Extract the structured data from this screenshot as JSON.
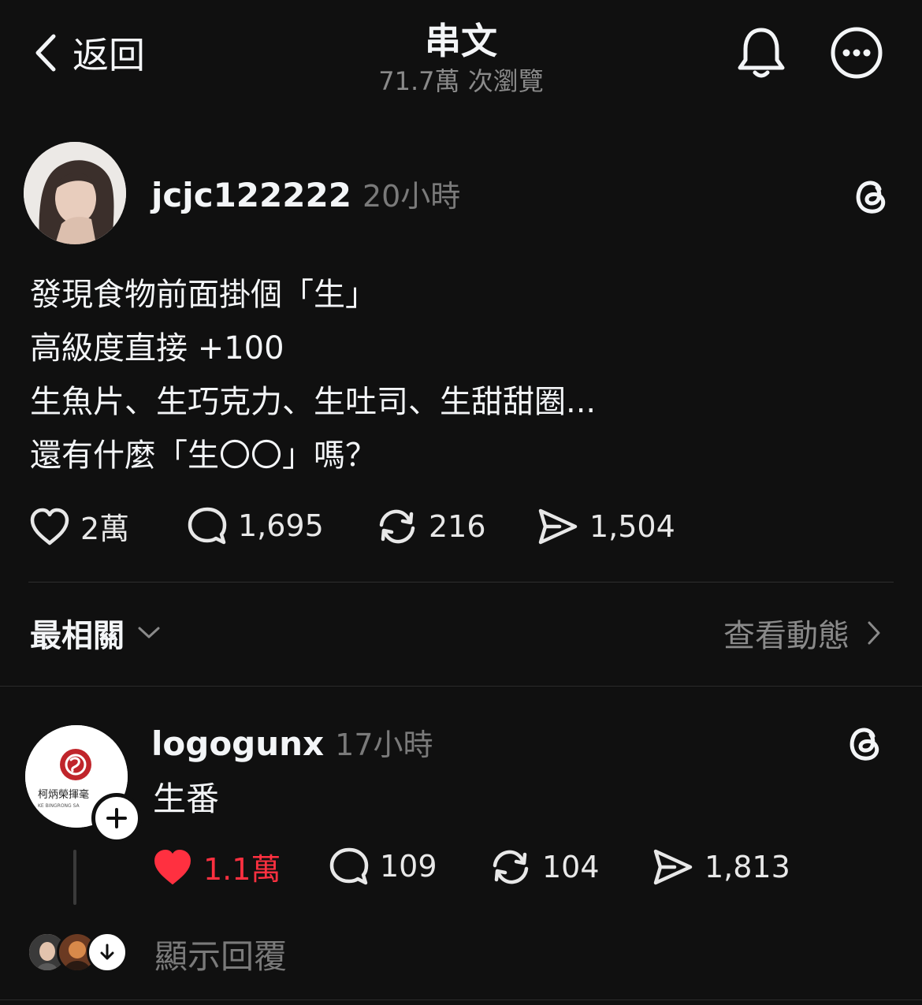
{
  "header": {
    "back_label": "返回",
    "title": "串文",
    "views": "71.7萬 次瀏覽"
  },
  "post": {
    "username": "jcjc122222",
    "time": "20小時",
    "lines": [
      "發現食物前面掛個「生」",
      "高級度直接 +100",
      "生魚片、生巧克力、生吐司、生甜甜圈...",
      "還有什麼「生〇〇」嗎？"
    ],
    "likes": "2萬",
    "comments": "1,695",
    "reposts": "216",
    "shares": "1,504"
  },
  "sort": {
    "label": "最相關",
    "activity_link": "查看動態"
  },
  "reply": {
    "username": "logogunx",
    "time": "17小時",
    "text": "生番",
    "likes": "1.1萬",
    "comments": "109",
    "reposts": "104",
    "shares": "1,813",
    "avatar_logo_text": "柯炳榮揮毫",
    "avatar_logo_sub": "KE BINGRONG SA",
    "show_replies": "顯示回覆"
  },
  "colors": {
    "background": "#101010",
    "text": "#f3f5f7",
    "muted": "#7a7a7a",
    "like_red": "#ff3040"
  }
}
